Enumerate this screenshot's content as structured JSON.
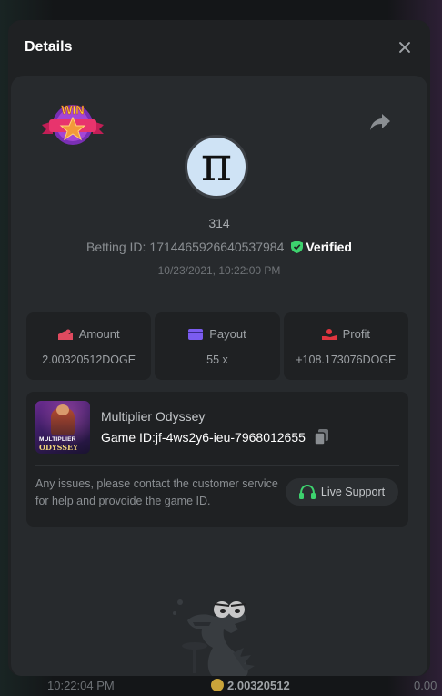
{
  "background": {
    "time": "10:22:04 PM",
    "amount": "2.00320512",
    "right_value": "0.00"
  },
  "modal": {
    "title": "Details",
    "close_label": "×"
  },
  "bet": {
    "username": "314",
    "betting_id_label": "Betting ID:",
    "betting_id": "1714465926640537984",
    "verified_label": "Verified",
    "timestamp": "10/23/2021, 10:22:00 PM",
    "win_badge_text": "WIN"
  },
  "stats": [
    {
      "label": "Amount",
      "value": "2.00320512DOGE",
      "icon": "coins-icon",
      "color": "#e04a5f"
    },
    {
      "label": "Payout",
      "value": "55 x",
      "icon": "card-icon",
      "color": "#7b5cf0"
    },
    {
      "label": "Profit",
      "value": "+108.173076DOGE",
      "icon": "hand-coin-icon",
      "color": "#e0353f"
    }
  ],
  "game": {
    "name": "Multiplier Odyssey",
    "id_label": "Game ID:",
    "id_value": "jf-4ws2y6-ieu-7968012655",
    "thumb_line1": "MULTIPLIER",
    "thumb_line2": "ODYSSEY",
    "support_text": "Any issues, please contact the customer service for help and provoide the game ID.",
    "support_button": "Live Support"
  },
  "colors": {
    "verified": "#3dd26e",
    "support_icon": "#3dd26e",
    "modal_bg": "#1f2123",
    "panel_bg": "#272a2d"
  }
}
